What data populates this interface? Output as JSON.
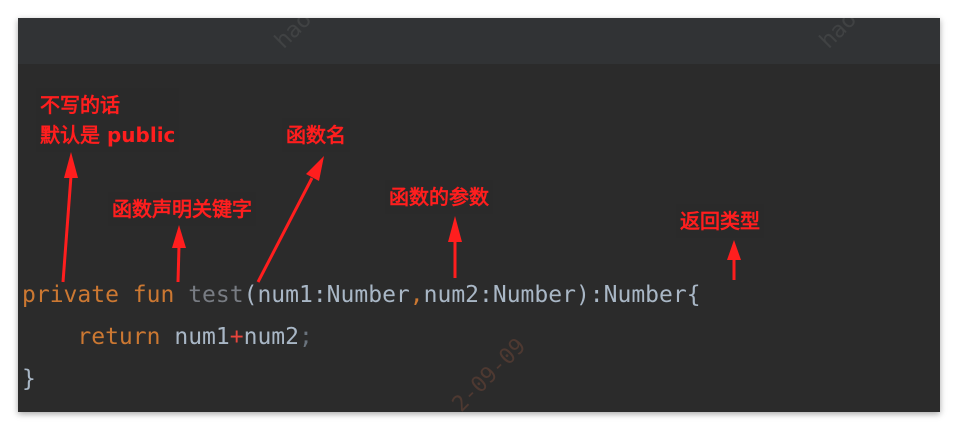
{
  "code": {
    "line1": {
      "kw_private": "private",
      "kw_fun": "fun",
      "fn_name": "test",
      "params": "(num1:Number",
      "comma": ",",
      "params2": "num2:Number):Number{"
    },
    "line2": {
      "kw_return": "return",
      "lhs": "num1",
      "op": "+",
      "rhs": "num2",
      "semi": ";"
    },
    "line3": {
      "brace": "}"
    }
  },
  "annotations": {
    "default_visibility_line1": "不写的话",
    "default_visibility_line2": "默认是 public",
    "fun_keyword": "函数声明关键字",
    "function_name": "函数名",
    "parameters": "函数的参数",
    "return_type": "返回类型"
  },
  "colors": {
    "background": "#2b2b2b",
    "keyword": "#cc7832",
    "identifier": "#a9b7c6",
    "function_name": "#787c83",
    "annotation": "#ff1e1e"
  }
}
